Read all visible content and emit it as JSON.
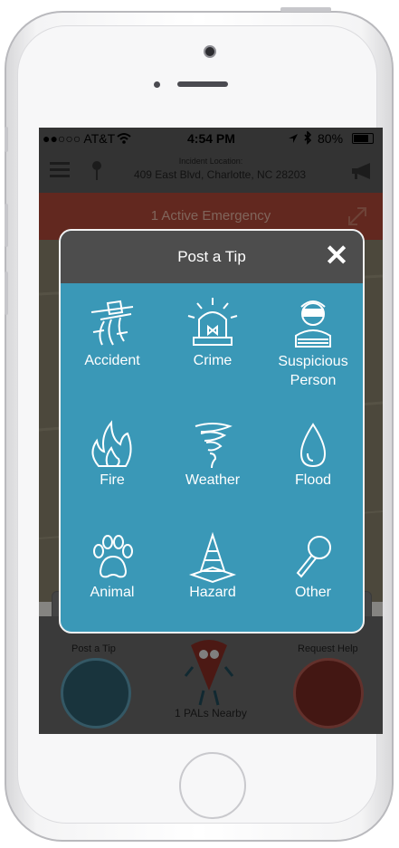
{
  "status": {
    "carrier": "●●○○○ AT&T",
    "time": "4:54 PM",
    "battery": "80%"
  },
  "header": {
    "location_title": "Incident Location:",
    "location_address": "409 East Blvd, Charlotte, NC  28203"
  },
  "banner": {
    "text": "1 Active Emergency"
  },
  "modal": {
    "title": "Post a Tip",
    "options": [
      {
        "label": "Accident",
        "icon": "accident-icon"
      },
      {
        "label": "Crime",
        "icon": "siren-icon"
      },
      {
        "label": "Suspicious Person",
        "icon": "burglar-icon"
      },
      {
        "label": "Fire",
        "icon": "fire-icon"
      },
      {
        "label": "Weather",
        "icon": "tornado-icon"
      },
      {
        "label": "Flood",
        "icon": "water-drop-icon"
      },
      {
        "label": "Animal",
        "icon": "paw-icon"
      },
      {
        "label": "Hazard",
        "icon": "traffic-cone-icon"
      },
      {
        "label": "Other",
        "icon": "magnifier-icon"
      }
    ]
  },
  "bottom": {
    "post_tip_label": "Post a Tip",
    "request_help_label": "Request Help",
    "nearby_text": "1 PALs Nearby"
  },
  "colors": {
    "modal_body": "#3a98b7",
    "modal_header": "#4d4d4d",
    "banner": "#b24a3a"
  }
}
